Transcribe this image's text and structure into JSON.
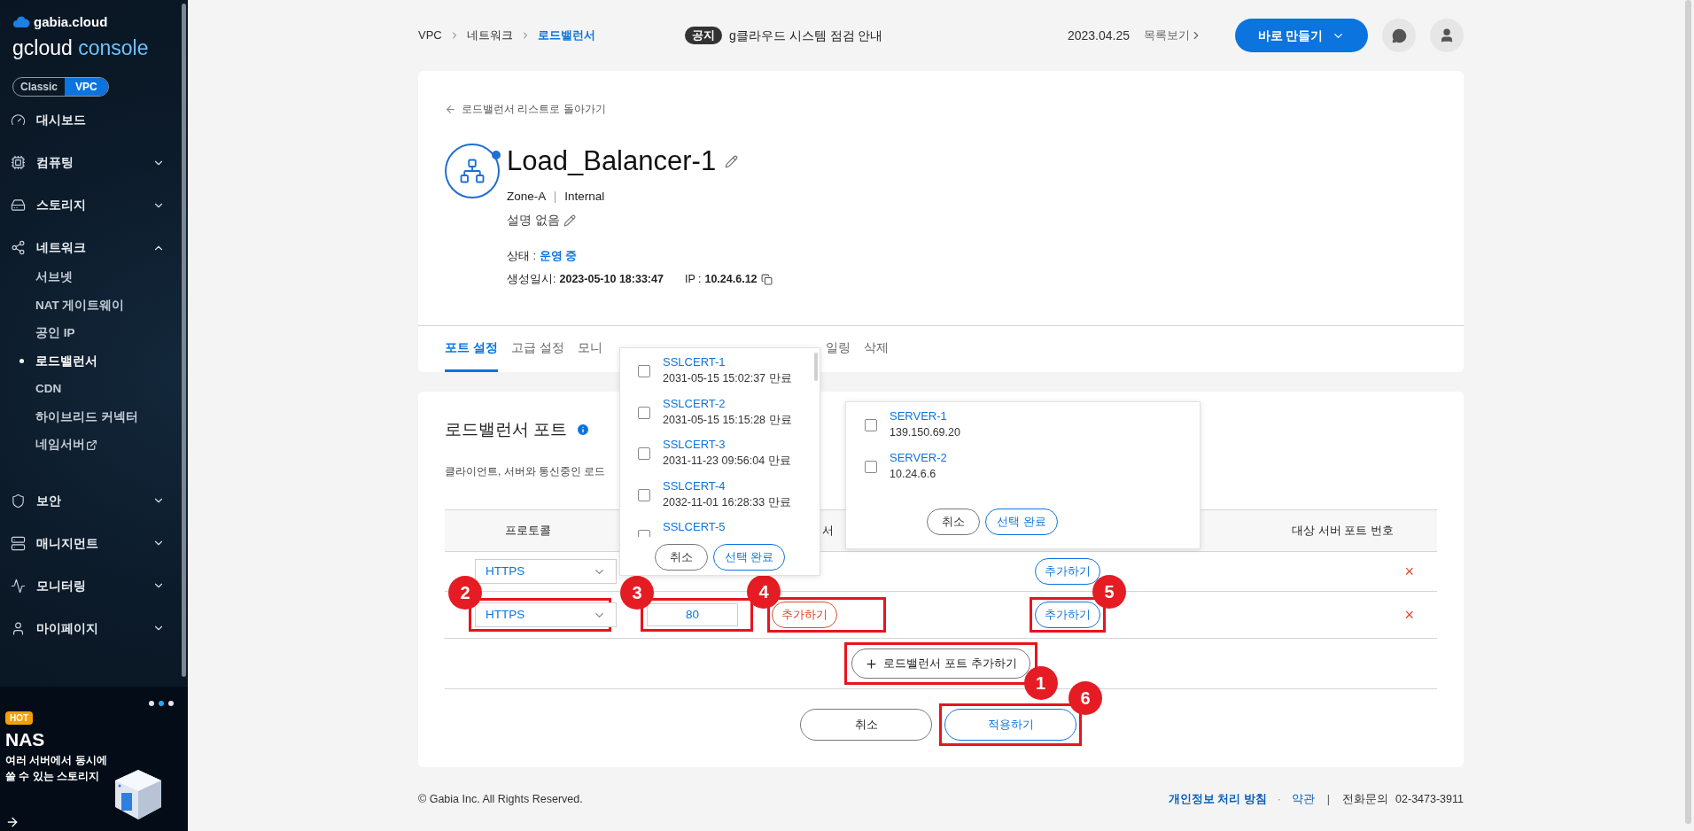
{
  "sidebar": {
    "brand": "gabia.cloud",
    "title": "gcloud",
    "title_accent": "console",
    "modes": [
      {
        "label": "Classic",
        "selected": false
      },
      {
        "label": "VPC",
        "selected": true
      }
    ],
    "menu": [
      {
        "label": "대시보드",
        "kind": "link"
      },
      {
        "label": "컴퓨팅",
        "kind": "group",
        "expanded": false
      },
      {
        "label": "스토리지",
        "kind": "group",
        "expanded": false
      },
      {
        "label": "네트워크",
        "kind": "group",
        "expanded": true,
        "children": [
          {
            "label": "서브넷",
            "selected": false,
            "external": false
          },
          {
            "label": "NAT 게이트웨이",
            "selected": false,
            "external": false
          },
          {
            "label": "공인 IP",
            "selected": false,
            "external": false
          },
          {
            "label": "로드밸런서",
            "selected": true,
            "external": false
          },
          {
            "label": "CDN",
            "selected": false,
            "external": false
          },
          {
            "label": "하이브리드 커넥터",
            "selected": false,
            "external": false
          },
          {
            "label": "네임서버",
            "selected": false,
            "external": true
          }
        ]
      },
      {
        "label": "보안",
        "kind": "group",
        "expanded": false
      },
      {
        "label": "매니지먼트",
        "kind": "group",
        "expanded": false
      },
      {
        "label": "모니터링",
        "kind": "group",
        "expanded": false
      },
      {
        "label": "마이페이지",
        "kind": "group",
        "expanded": false
      }
    ],
    "banner": {
      "dots": [
        {
          "selected": false
        },
        {
          "selected": true
        },
        {
          "selected": false
        }
      ],
      "badge": "HOT",
      "title": "NAS",
      "lines": [
        "여러 서버에서 동시에",
        "쓸 수 있는 스토리지"
      ]
    }
  },
  "header": {
    "breadcrumb": [
      "VPC",
      "네트워크",
      "로드밸런서"
    ],
    "notice_tag": "공지",
    "notice": "g클라우드 시스템 점검 안내",
    "date": "2023.04.25",
    "more": "목록보기",
    "create_button": "바로 만들기"
  },
  "detail": {
    "back_link": "로드밸런서 리스트로 돌아가기",
    "name": "Load_Balancer-1",
    "zone": "Zone-A",
    "type": "Internal",
    "description": "설명 없음",
    "status_label": "상태 :",
    "status": "운영 중",
    "created_label": "생성일시:",
    "created": "2023-05-10 18:33:47",
    "ip_label": "IP :",
    "ip": "10.24.6.12"
  },
  "tabs": [
    {
      "label": "포트 설정",
      "selected": true
    },
    {
      "label": "고급 설정",
      "selected": false
    },
    {
      "label": "모니",
      "selected": false
    },
    {
      "label": "일링",
      "selected": false
    },
    {
      "label": "삭제",
      "selected": false
    }
  ],
  "ports": {
    "title": "로드밸런서 포트",
    "description": "클라이언트, 서버와 통신중인 로드",
    "columns": [
      "프로토콜",
      "서",
      "대상 서버 포트 번호"
    ],
    "rows": [
      {
        "protocol": "HTTPS",
        "server_button": "추가하기",
        "delete": "×"
      },
      {
        "protocol": "HTTPS",
        "protocol_callout": "2",
        "port": "80",
        "port_callout": "3",
        "cert_button": "추가하기",
        "cert_required": true,
        "cert_callout": "4",
        "server_button": "추가하기",
        "server_callout": "5",
        "delete": "×"
      }
    ],
    "add_button": "로드밸런서 포트 추가하기",
    "add_callout": "1",
    "cancel_button": "취소",
    "apply_button": "적용하기",
    "apply_callout": "6"
  },
  "cert_popup": {
    "items": [
      {
        "name": "SSLCERT-1",
        "detail": "2031-05-15 15:02:37 만료",
        "checked": false
      },
      {
        "name": "SSLCERT-2",
        "detail": "2031-05-15 15:15:28 만료",
        "checked": false
      },
      {
        "name": "SSLCERT-3",
        "detail": "2031-11-23 09:56:04 만료",
        "checked": false
      },
      {
        "name": "SSLCERT-4",
        "detail": "2032-11-01 16:28:33 만료",
        "checked": false
      },
      {
        "name": "SSLCERT-5",
        "checked": false
      }
    ],
    "cancel": "취소",
    "confirm": "선택 완료"
  },
  "server_popup": {
    "items": [
      {
        "name": "SERVER-1",
        "detail": "139.150.69.20",
        "checked": false
      },
      {
        "name": "SERVER-2",
        "detail": "10.24.6.6",
        "checked": false
      }
    ],
    "cancel": "취소",
    "confirm": "선택 완료"
  },
  "footer": {
    "copyright": "© Gabia Inc. All Rights Reserved.",
    "privacy": "개인정보 처리 방침",
    "dot": "·",
    "terms": "약관",
    "separator": "|",
    "phone_label": "전화문의",
    "phone": "02-3473-3911"
  }
}
